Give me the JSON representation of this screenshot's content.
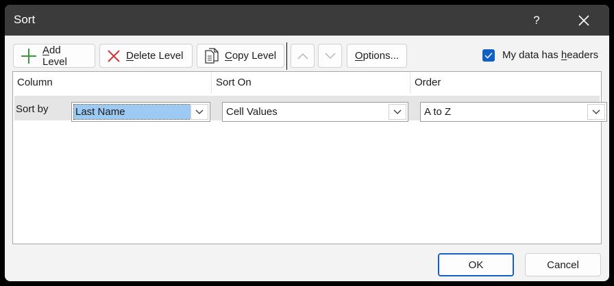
{
  "dialog": {
    "title": "Sort",
    "help_label": "?"
  },
  "toolbar": {
    "add_level": {
      "pre": "",
      "key": "A",
      "post": "dd Level"
    },
    "delete_level": {
      "pre": "",
      "key": "D",
      "post": "elete Level"
    },
    "copy_level": {
      "pre": "",
      "key": "C",
      "post": "opy Level"
    },
    "options": {
      "pre": "",
      "key": "O",
      "post": "ptions..."
    },
    "headers_checkbox": {
      "checked": true,
      "pre": "My data has ",
      "key": "h",
      "post": "eaders"
    }
  },
  "grid": {
    "columns": [
      "Column",
      "Sort On",
      "Order"
    ],
    "row_label": "Sort by",
    "row": {
      "column_value": "Last Name",
      "sort_on_value": "Cell Values",
      "order_value": "A to Z"
    }
  },
  "footer": {
    "ok_label": "OK",
    "cancel_label": "Cancel"
  },
  "colors": {
    "title_bar": "#3b3b3b",
    "accent": "#0f5fc6",
    "selection": "#9ccaf2",
    "add_icon": "#3a9a3a",
    "delete_icon": "#d13438"
  },
  "icons": [
    "plus-icon",
    "x-icon",
    "copy-icon",
    "chevron-up-icon",
    "chevron-down-icon",
    "check-icon",
    "close-icon"
  ]
}
